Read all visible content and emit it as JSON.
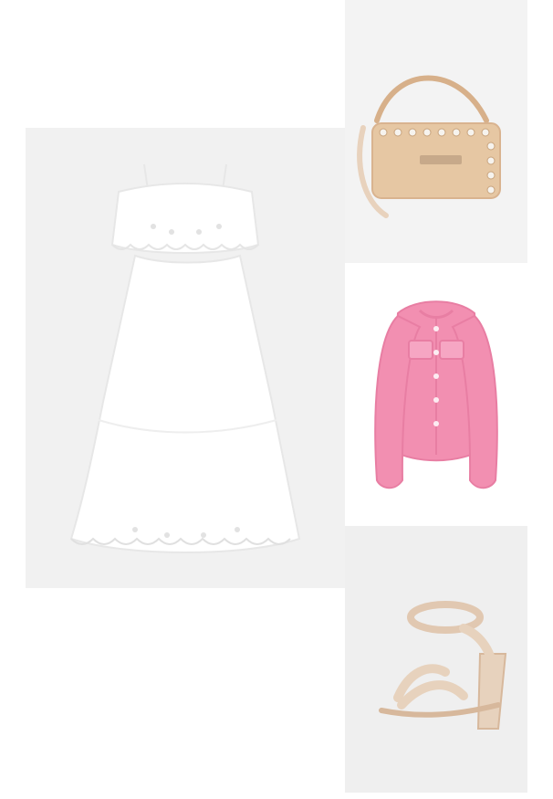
{
  "outfit": {
    "items": [
      {
        "name": "white-eyelet-maxi-dress",
        "color": "#ffffff"
      },
      {
        "name": "beige-studded-shoulder-bag",
        "color": "#e6c7a3"
      },
      {
        "name": "pink-knit-cardigan",
        "color": "#f28fb1"
      },
      {
        "name": "nude-block-heel-sandals",
        "color": "#e7d2bd"
      }
    ]
  },
  "colors": {
    "page_background": "#ffffff",
    "tile_background": "#f1f1f1",
    "dress": "#ffffff",
    "bag": "#e6c7a3",
    "cardigan": "#f28fb1",
    "sandals": "#e7d2bd"
  }
}
